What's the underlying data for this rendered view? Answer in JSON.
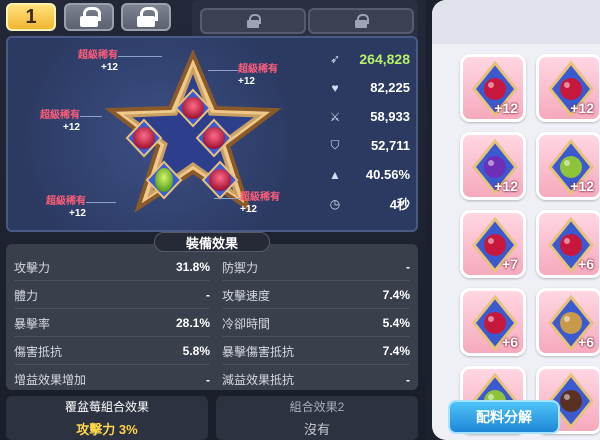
{
  "tabs": {
    "active_number": "1"
  },
  "stats": [
    {
      "icon": "attack-icon",
      "value": "264,828"
    },
    {
      "icon": "heart-icon",
      "value": "82,225"
    },
    {
      "icon": "sword-icon",
      "value": "58,933"
    },
    {
      "icon": "shield-icon",
      "value": "52,711"
    },
    {
      "icon": "critical-icon",
      "value": "40.56%"
    },
    {
      "icon": "cooldown-icon",
      "value": "4秒"
    }
  ],
  "slots": [
    {
      "rarity": "超級稀有",
      "bonus": "+12"
    },
    {
      "rarity": "超級稀有",
      "bonus": "+12"
    },
    {
      "rarity": "超級稀有",
      "bonus": "+12"
    },
    {
      "rarity": "超級稀有",
      "bonus": "+12"
    },
    {
      "rarity": "超級稀有",
      "bonus": "+12"
    }
  ],
  "effects": {
    "header": "裝備效果",
    "rows": [
      {
        "label": "攻擊力",
        "value": "31.8%"
      },
      {
        "label": "防禦力",
        "value": "-"
      },
      {
        "label": "體力",
        "value": "-"
      },
      {
        "label": "攻擊速度",
        "value": "7.4%"
      },
      {
        "label": "暴擊率",
        "value": "28.1%"
      },
      {
        "label": "冷卻時間",
        "value": "5.4%"
      },
      {
        "label": "傷害抵抗",
        "value": "5.8%"
      },
      {
        "label": "暴擊傷害抵抗",
        "value": "7.4%"
      },
      {
        "label": "增益效果增加",
        "value": "-"
      },
      {
        "label": "減益效果抵抗",
        "value": "-"
      }
    ]
  },
  "combos": {
    "first_title": "覆盆莓組合效果",
    "first_value": "攻擊力 3%",
    "second_title": "組合效果2",
    "second_value": "沒有"
  },
  "inventory": {
    "items": [
      {
        "jelly": "raspberry",
        "amount": "+12"
      },
      {
        "jelly": "raspberry",
        "amount": "+12"
      },
      {
        "jelly": "grape",
        "amount": "+12"
      },
      {
        "jelly": "green-grape",
        "amount": "+12"
      },
      {
        "jelly": "raspberry",
        "amount": "+7"
      },
      {
        "jelly": "raspberry",
        "amount": "+6"
      },
      {
        "jelly": "raspberry",
        "amount": "+6"
      },
      {
        "jelly": "almond",
        "amount": "+6"
      },
      {
        "jelly": "green-grape",
        "amount": ""
      },
      {
        "jelly": "chocolate",
        "amount": ""
      }
    ],
    "decompose_label": "配料分解"
  },
  "colors": {
    "rarity_text": "#ff5d7a",
    "highlight_stat": "#b7f06a",
    "combo_value": "#ffd54a",
    "button_blue": "#1d86d6"
  }
}
